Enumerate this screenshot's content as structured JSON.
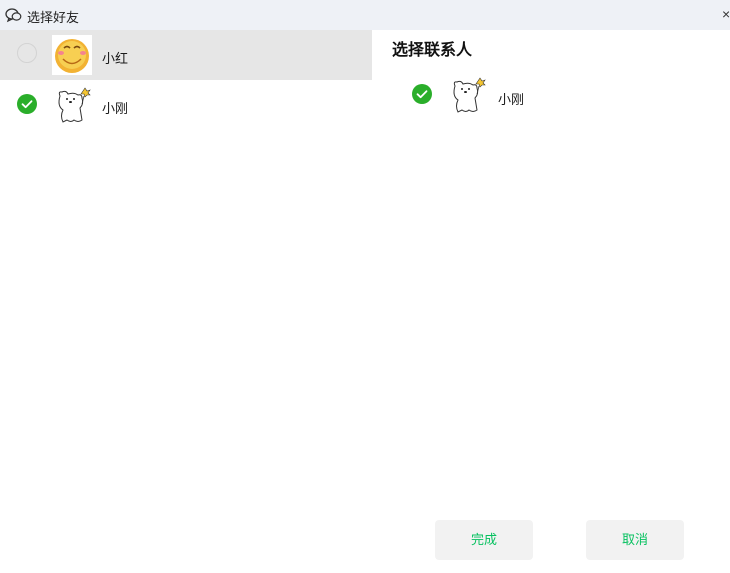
{
  "window": {
    "title": "选择好友",
    "close_glyph": "×"
  },
  "left_list": {
    "items": [
      {
        "name": "小红",
        "selected": false,
        "avatar": "smiley-face-avatar"
      },
      {
        "name": "小刚",
        "selected": true,
        "avatar": "white-bear-avatar"
      }
    ]
  },
  "right_panel": {
    "title": "选择联系人",
    "selected": [
      {
        "name": "小刚",
        "avatar": "white-bear-avatar"
      }
    ]
  },
  "buttons": {
    "done_label": "完成",
    "cancel_label": "取消"
  },
  "colors": {
    "accent_green": "#07c160",
    "check_green": "#2aae2a",
    "titlebar_bg": "#eef1f6",
    "hover_bg": "#e6e6e6",
    "button_bg": "#f2f2f2"
  },
  "icons": {
    "app": "chat-bubbles-icon",
    "close": "close-icon",
    "unchecked": "radio-unchecked-icon",
    "checked": "checkmark-circle-icon"
  }
}
